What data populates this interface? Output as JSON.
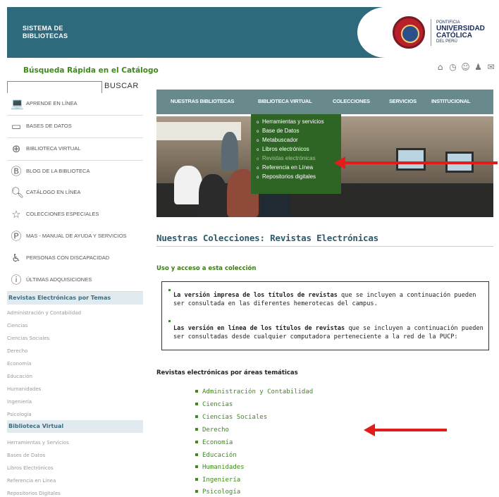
{
  "header": {
    "system_line1": "SISTEMA DE",
    "system_line2": "BIBLIOTECAS",
    "uni_line1": "PONTIFICIA",
    "uni_line2": "UNIVERSIDAD",
    "uni_line3": "CATÓLICA",
    "uni_line4": "DEL PERÚ"
  },
  "quick_search": {
    "title": "Búsqueda Rápida en el Catálogo",
    "value": "",
    "button": "BUSCAR"
  },
  "menu": [
    {
      "label": "APRENDE EN LÍNEA",
      "icon": "laptop-icon"
    },
    {
      "label": "BASES DE DATOS",
      "icon": "folder-icon"
    },
    {
      "label": "BIBLIOTECA VIRTUAL",
      "icon": "globe-icon"
    },
    {
      "label": "BLOG DE LA BIBLIOTECA",
      "icon": "blog-icon"
    },
    {
      "label": "CATÁLOGO EN LÍNEA",
      "icon": "search-icon"
    },
    {
      "label": "COLECCIONES ESPECIALES",
      "icon": "star-icon"
    },
    {
      "label": "MAS - MANUAL DE AYUDA Y SERVICIOS",
      "icon": "help-icon"
    },
    {
      "label": "PERSONAS CON DISCAPACIDAD",
      "icon": "wheelchair-icon"
    },
    {
      "label": "ÚLTIMAS ADQUISICIONES",
      "icon": "info-icon"
    }
  ],
  "sidebar_topics": {
    "title": "Revistas Electrónicas por Temas",
    "items": [
      "Administración y Contabilidad",
      "Ciencias",
      "Ciencias Sociales",
      "Derecho",
      "Economía",
      "Educación",
      "Humanidades",
      "Ingeniería",
      "Psicología"
    ]
  },
  "sidebar_virtual": {
    "title": "Biblioteca Virtual",
    "items": [
      "Herramientas y Servicios",
      "Bases de Datos",
      "Libros Electrónicos",
      "Referencia en Línea",
      "Repositorios Digitales"
    ]
  },
  "top_icons": [
    "home-icon",
    "clock-icon",
    "user-icon",
    "people-icon",
    "mail-icon"
  ],
  "nav": [
    "NUESTRAS BIBLIOTECAS",
    "BIBLIOTECA VIRTUAL",
    "COLECCIONES",
    "SERVICIOS",
    "INSTITUCIONAL"
  ],
  "dropdown": [
    "Herramientas y servicios",
    "Base de Datos",
    "Metabuscador",
    "Libros electrónicos",
    "Revistas electrónicas",
    "Referencia en Línea",
    "Repositorios digitales"
  ],
  "content": {
    "heading": "Nuestras Colecciones: Revistas Electrónicas",
    "usage_title": "Uso y acceso a esta colección",
    "para1_bold": "La versión impresa de los títulos de revistas",
    "para1_rest": " que se incluyen a continuación pueden ser consultada en las diferentes hemerotecas del campus.",
    "para2_bold": "Las versión en línea de los títulos de revistas",
    "para2_rest": " que se incluyen a continuación pueden ser consultadas desde cualquier computadora perteneciente a la red de la PUCP:",
    "areas_title": "Revistas electrónicas por áreas temáticas",
    "areas": [
      "Administración y Contabilidad",
      "Ciencias",
      "Ciencias Sociales",
      "Derecho",
      "Economía",
      "Educación",
      "Humanidades",
      "Ingeniería",
      "Psicología"
    ]
  },
  "colors": {
    "header_bg": "#2f6a7c",
    "nav_bg": "#688a8c",
    "dropdown_bg": "#2f6524",
    "accent_green": "#3e8a1c",
    "arrow_red": "#e41b1b"
  }
}
